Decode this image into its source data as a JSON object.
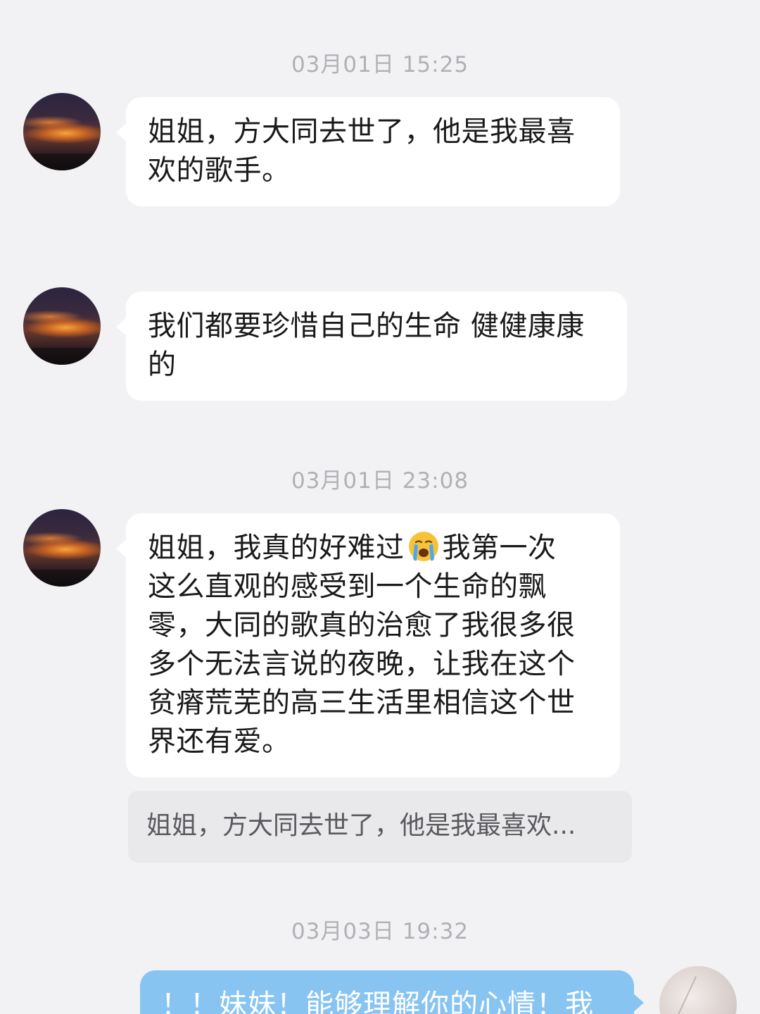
{
  "messages": [
    {
      "timestamp": "03月01日 15:25",
      "lines": [
        "姐姐，方大同去世了，他是我最喜",
        "欢的歌手。"
      ]
    },
    {
      "lines": [
        "我们都要珍惜自己的生命 健健康康",
        "的"
      ]
    },
    {
      "timestamp": "03月01日 23:08",
      "line1_before_emoji": "姐姐，我真的好难过",
      "emoji": "loudly-crying-face",
      "line1_after_emoji": "我第一次",
      "lines": [
        "这么直观的感受到一个生命的飘",
        "零，大同的歌真的治愈了我很多很",
        "多个无法言说的夜晚，让我在这个",
        "贫瘠荒芜的高三生活里相信这个世",
        "界还有爱。"
      ]
    }
  ],
  "quoted_reply": "姐姐，方大同去世了，他是我最喜欢...",
  "self_message": {
    "timestamp": "03月03日 19:32",
    "text": "！！妹妹！能够理解你的心情！我"
  },
  "colors": {
    "background": "#f2f2f4",
    "incoming_bubble": "#ffffff",
    "outgoing_bubble": "#88c4f2",
    "quote_bg": "#e9e9ec",
    "timestamp": "#b0b0b6"
  }
}
